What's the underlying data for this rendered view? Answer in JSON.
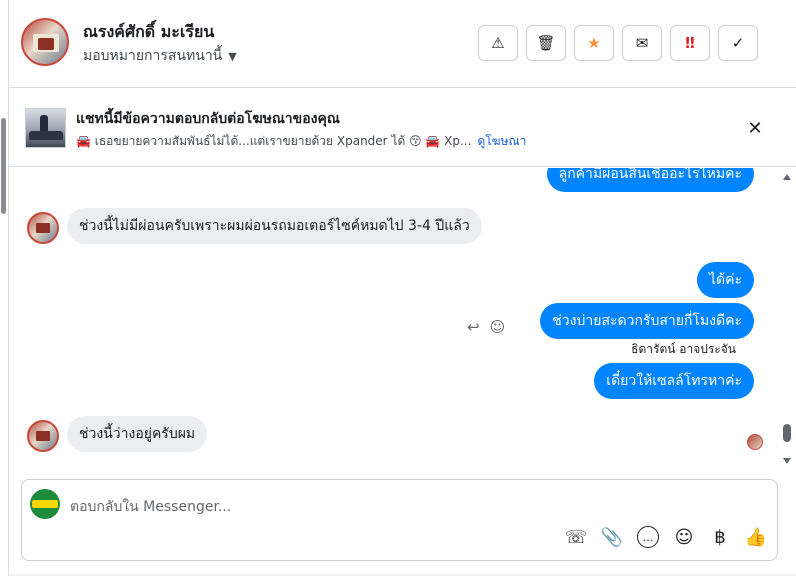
{
  "header": {
    "contact_name": "ณรงค์ศักดิ์ มะเรียน",
    "assign_label": "มอบหมายการสนทนานี้",
    "buttons": {
      "warn": "⚠",
      "trash": "🗑",
      "star": "★",
      "mail": "✉",
      "spam": "‼",
      "done": "✓"
    }
  },
  "ad_banner": {
    "title": "แชทนี้มีข้อความตอบกลับต่อโฆษณาของคุณ",
    "snippet": "🚘 เธอขยายความสัมพันธ์ไม่ได้...แต่เราขยายด้วย Xpander ได้ 😚 🚘 Xp...",
    "link": "ดูโฆษณา",
    "close": "✕"
  },
  "messages": [
    {
      "direction": "out",
      "text": "ลูกค้ามีผ่อนสินเชื่ออะไรไหมคะ"
    },
    {
      "direction": "in",
      "text": "ช่วงนี้ไม่มีผ่อนครับเพราะผมผ่อนรถมอเตอร์ไซค์หมดไป 3-4 ปีแล้ว"
    },
    {
      "direction": "out",
      "text": "ได้ค่ะ"
    },
    {
      "direction": "out",
      "text": "ช่วงบ่ายสะดวกรับสายกี่โมงดีคะ"
    },
    {
      "direction": "out",
      "text": "เดี๋ยวให้เซลล์โทรหาค่ะ"
    },
    {
      "direction": "in",
      "text": "ช่วงนี้ว่างอยู่ครับผม"
    }
  ],
  "sender_label": "ธิดารัตน์ อาจประจัน",
  "message_actions": {
    "reply": "↩",
    "react": "☺"
  },
  "composer": {
    "placeholder": "ตอบกลับใน Messenger...",
    "tools": {
      "call": "☏",
      "attach": "📎",
      "saved_reply": "…",
      "emoji": "☺",
      "payment": "฿",
      "like": "👍"
    }
  }
}
